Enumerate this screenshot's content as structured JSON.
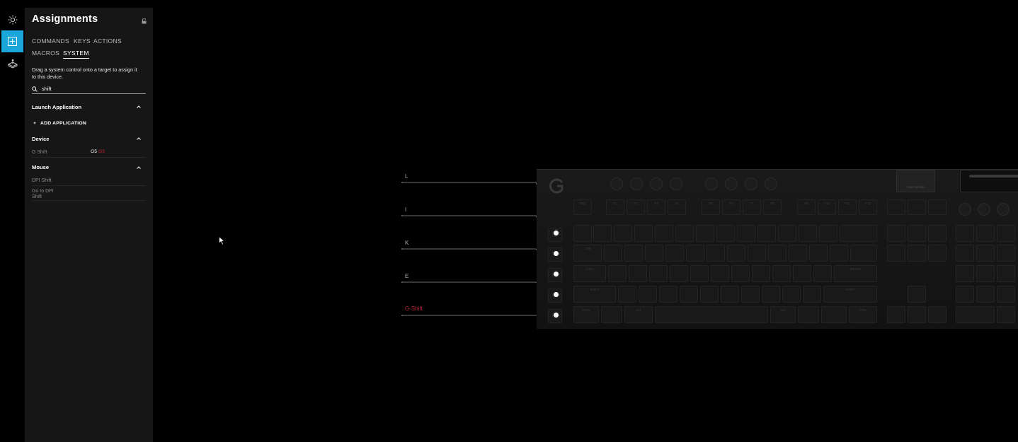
{
  "panel": {
    "title": "Assignments",
    "tabs_row1": [
      "COMMANDS",
      "KEYS",
      "ACTIONS"
    ],
    "tabs_row2": [
      "MACROS",
      "SYSTEM"
    ],
    "active_tab": "SYSTEM",
    "description": "Drag a system control onto a target to assign it to this device.",
    "search_value": "shift",
    "sections": {
      "launch": {
        "title": "Launch Application",
        "add_label": "ADD APPLICATION"
      },
      "device": {
        "title": "Device",
        "items": [
          {
            "label": "G Shift",
            "key": "G5",
            "key_alt": "G5"
          }
        ]
      },
      "mouse": {
        "title": "Mouse",
        "items": [
          {
            "label": "DPI Shift"
          },
          {
            "label": "Go to DPI Shift"
          }
        ]
      }
    }
  },
  "callouts": [
    {
      "label": "L"
    },
    {
      "label": "I"
    },
    {
      "label": "K"
    },
    {
      "label": "E"
    },
    {
      "label": "G-Shift"
    }
  ],
  "keyboard": {
    "keys": {
      "esc": "ESC",
      "f1": "F1",
      "f2": "F2",
      "f3": "F3",
      "f4": "F4",
      "f5": "F5",
      "f6": "F6",
      "f7": "F7",
      "f8": "F8",
      "f9": "F9",
      "f10": "F10",
      "f11": "F11",
      "f12": "F12",
      "tab": "TAB",
      "caps": "CAPS",
      "shift": "SHIFT",
      "ctrl": "CTRL",
      "alt": "ALT",
      "enter": "ENTER",
      "rshift": "SHIFT",
      "rctrl": "CTRL",
      "ralt": "ALT",
      "lightspeed": "LIGHTSPEED"
    }
  },
  "colors": {
    "accent": "#1aa6d9",
    "highlight_red": "#c0233a"
  }
}
